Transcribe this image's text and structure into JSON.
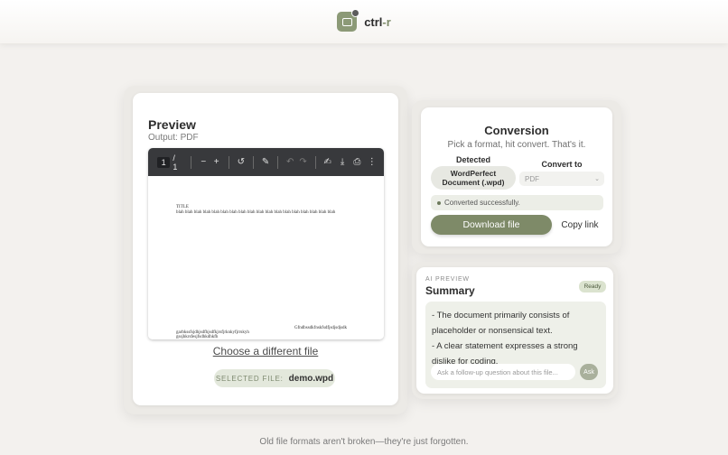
{
  "header": {
    "brand_main": "ctrl",
    "brand_accent": "-r",
    "logo_icon": "document-convert-icon"
  },
  "preview": {
    "title": "Preview",
    "output_label": "Output: PDF",
    "toolbar": {
      "page_current": "1",
      "page_total": "/ 1",
      "zoom_out": "−",
      "zoom_in": "+",
      "rotate_icon": "↺",
      "annotate_icon": "✎",
      "undo_icon": "↶",
      "redo_icon": "↷",
      "sign_icon": "✍",
      "download_icon": "⤓",
      "print_icon": "⎙",
      "more_icon": "⋮"
    },
    "document": {
      "title": "TITLE",
      "line1": "blah blah blah blah blah blah blah blah blah blah blah blah blah blah blah blah blah blah",
      "right_text": "Gfndbssdkfnskfsdfjsdjsdjsdk",
      "left_text1": "garbkssfsjdhjsdfhjsdfkjrsfjrknkyfjrrskyh",
      "left_text2": "gssjhkrsfesjfsdhkdhkfh"
    },
    "choose_link": "Choose a different file",
    "selected_file_label": "SELECTED FILE:",
    "selected_file_name": "demo.wpd"
  },
  "conversion": {
    "title": "Conversion",
    "subtitle": "Pick a format, hit convert. That's it.",
    "detected_label": "Detected",
    "detected_value": "WordPerfect Document (.wpd)",
    "convert_to_label": "Convert to",
    "convert_to_value": "PDF",
    "status_text": "Converted successfully.",
    "download_label": "Download file",
    "copy_label": "Copy link"
  },
  "ai": {
    "kicker": "AI PREVIEW",
    "title": "Summary",
    "badge": "Ready",
    "summary_line1": "- The document primarily consists of placeholder or nonsensical text.",
    "summary_line2": "- A clear statement expresses a strong dislike for coding.",
    "ask_placeholder": "Ask a follow-up question about this file...",
    "ask_button": "Ask"
  },
  "footer": {
    "text": "Old file formats aren't broken—they're just forgotten."
  },
  "colors": {
    "accent": "#7e8a68",
    "background": "#f3f1ee",
    "toolbar": "#38393c"
  }
}
